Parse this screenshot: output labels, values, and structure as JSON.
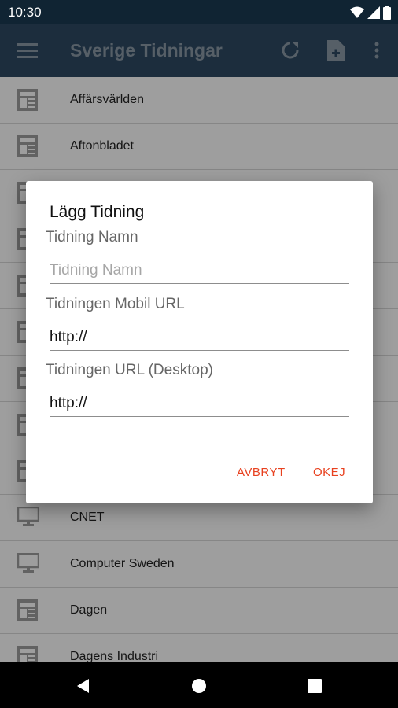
{
  "status": {
    "time": "10:30"
  },
  "appbar": {
    "title": "Sverige Tidningar",
    "menu_icon": "hamburger-menu-icon",
    "refresh_icon": "refresh-icon",
    "add_icon": "add-document-icon",
    "overflow_icon": "overflow-menu-icon"
  },
  "list": {
    "items": [
      {
        "label": "Affärsvärlden",
        "icon": "newspaper-icon"
      },
      {
        "label": "Aftonbladet",
        "icon": "newspaper-icon"
      },
      {
        "label": "",
        "icon": "newspaper-icon"
      },
      {
        "label": "",
        "icon": "newspaper-icon"
      },
      {
        "label": "",
        "icon": "newspaper-icon"
      },
      {
        "label": "",
        "icon": "newspaper-icon"
      },
      {
        "label": "",
        "icon": "newspaper-icon"
      },
      {
        "label": "",
        "icon": "newspaper-icon"
      },
      {
        "label": "",
        "icon": "newspaper-icon"
      },
      {
        "label": "CNET",
        "icon": "monitor-icon"
      },
      {
        "label": "Computer Sweden",
        "icon": "monitor-icon"
      },
      {
        "label": "Dagen",
        "icon": "newspaper-icon"
      },
      {
        "label": "Dagens Industri",
        "icon": "newspaper-icon"
      }
    ]
  },
  "dialog": {
    "title": "Lägg Tidning",
    "name_label": "Tidning Namn",
    "name_placeholder": "Tidning Namn",
    "name_value": "",
    "mobile_label": "Tidningen Mobil URL",
    "mobile_value": "http://",
    "desktop_label": "Tidningen URL (Desktop)",
    "desktop_value": "http://",
    "cancel_label": "AVBRYT",
    "ok_label": "OKEJ"
  },
  "colors": {
    "appbar": "#2e4a63",
    "statusbar": "#102433",
    "accent": "#e8411f"
  }
}
